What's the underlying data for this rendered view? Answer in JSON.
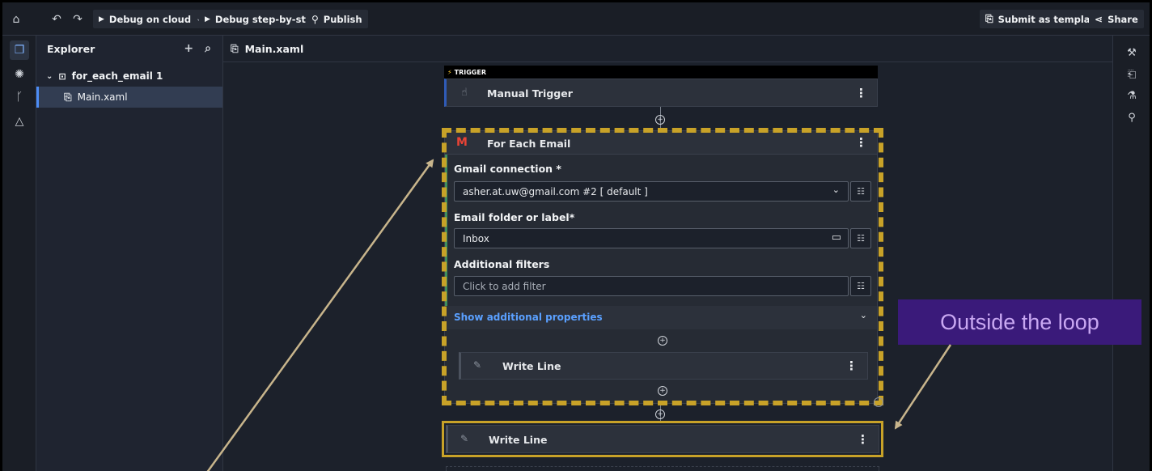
{
  "toolbar": {
    "debug_cloud": "Debug on cloud",
    "debug_step": "Debug step-by-step",
    "publish": "Publish",
    "submit_template": "Submit as template",
    "share": "Share"
  },
  "explorer": {
    "title": "Explorer",
    "project": "for_each_email 1",
    "file": "Main.xaml"
  },
  "editor": {
    "tab": "Main.xaml"
  },
  "workflow": {
    "trigger_badge": "TRIGGER",
    "trigger_title": "Manual Trigger",
    "loop_title": "For Each Email",
    "gmail_label": "Gmail connection *",
    "gmail_value": "asher.at.uw@gmail.com #2 [ default ]",
    "folder_label": "Email folder or label*",
    "folder_value": "Inbox",
    "filters_label": "Additional filters",
    "filters_placeholder": "Click to add filter",
    "show_props": "Show additional properties",
    "inner_activity": "Write Line",
    "outer_activity": "Write Line"
  },
  "annotation": {
    "callout": "Outside the loop"
  },
  "colors": {
    "accent_gold": "#c8a228",
    "callout_bg": "#3a1a7a",
    "link_blue": "#5aa0ff"
  }
}
